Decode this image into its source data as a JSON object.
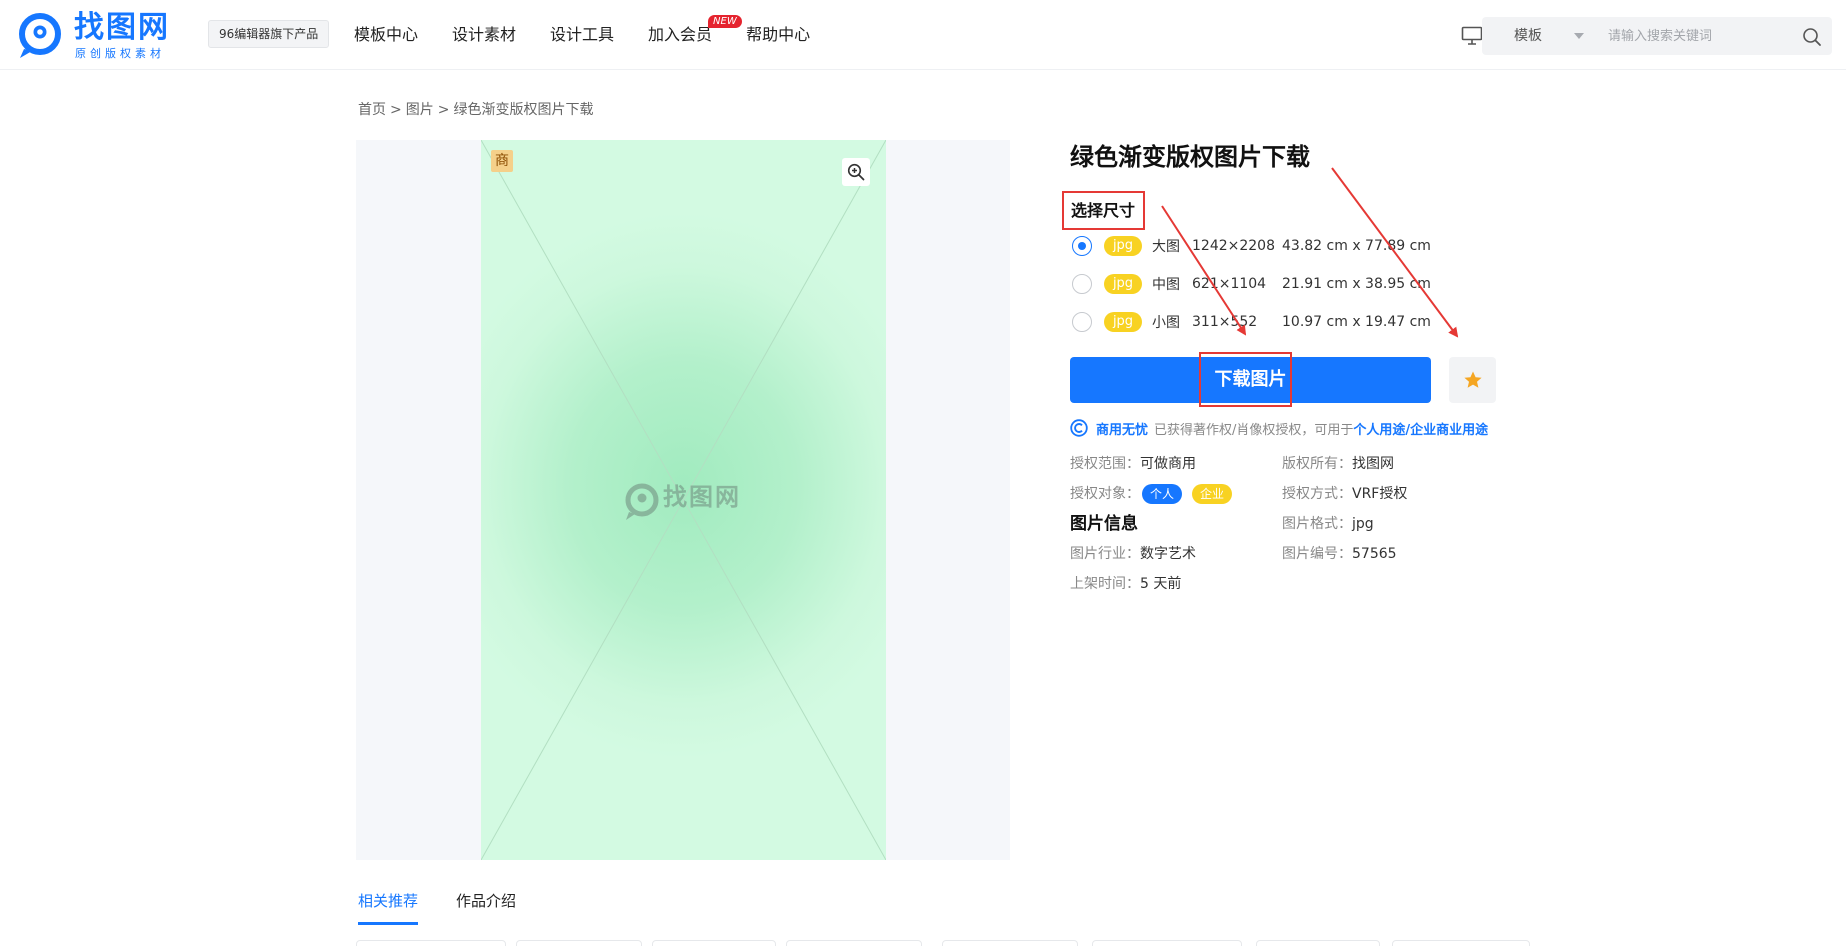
{
  "header": {
    "logo_name": "找图网",
    "logo_sub": "原创版权素材",
    "brand_badge": "96编辑器旗下产品",
    "nav": [
      "模板中心",
      "设计素材",
      "设计工具",
      "加入会员",
      "帮助中心"
    ],
    "new_badge": "NEW",
    "search": {
      "type": "模板",
      "placeholder": "请输入搜索关键词"
    }
  },
  "breadcrumb": [
    "首页",
    "图片",
    "绿色渐变版权图片下载"
  ],
  "breadcrumb_sep": ">",
  "preview": {
    "commercial_tag": "商",
    "watermark_text": "找图网",
    "background_colors": [
      "#cdf8dd",
      "#a1ebbf"
    ]
  },
  "product": {
    "title": "绿色渐变版权图片下载",
    "size_heading": "选择尺寸",
    "sizes": [
      {
        "format": "jpg",
        "name": "大图",
        "pixels": "1242×2208",
        "cm": "43.82 cm x 77.89 cm",
        "selected": true
      },
      {
        "format": "jpg",
        "name": "中图",
        "pixels": "621×1104",
        "cm": "21.91 cm x 38.95 cm",
        "selected": false
      },
      {
        "format": "jpg",
        "name": "小图",
        "pixels": "311×552",
        "cm": "10.97 cm x 19.47 cm",
        "selected": false
      }
    ],
    "download_label": "下载图片",
    "favorite_icon": "star-icon",
    "copyright": {
      "strong": "商用无忧",
      "text": "已获得著作权/肖像权授权，可用于",
      "link": "个人用途/企业商业用途"
    },
    "license": {
      "scope_key": "授权范围：",
      "scope_value": "可做商用",
      "owner_key": "版权所有：",
      "owner_value": "找图网",
      "target_key": "授权对象：",
      "target_values": [
        "个人",
        "企业"
      ],
      "method_key": "授权方式：",
      "method_value": "VRF授权"
    },
    "info_title": "图片信息",
    "info": {
      "format_key": "图片格式：",
      "format_value": "jpg",
      "industry_key": "图片行业：",
      "industry_value": "数字艺术",
      "id_key": "图片编号：",
      "id_value": "57565",
      "time_key": "上架时间：",
      "time_value": "5 天前"
    }
  },
  "tabs": [
    {
      "label": "相关推荐",
      "active": true
    },
    {
      "label": "作品介绍",
      "active": false
    }
  ],
  "colors": {
    "accent": "#1677ff",
    "badge_yellow": "#f8d222",
    "annotation_red": "#e53935",
    "new_red": "#e5232e"
  }
}
